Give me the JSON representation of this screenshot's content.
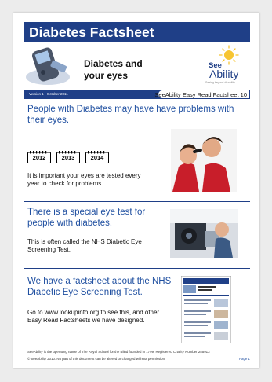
{
  "header": {
    "title": "Diabetes Factsheet",
    "subtitle": "Diabetes and\nyour eyes",
    "logo_see": "See",
    "logo_ability": "Ability",
    "logo_tagline": "Seeing beyond disability",
    "version": "Version 1 - October 2011",
    "series": "SeeAbility Easy Read Factsheet 10"
  },
  "section1": {
    "heading": "People with Diabetes may have have problems with their eyes.",
    "calendar_years": [
      "2012",
      "2013",
      "2014"
    ],
    "body": "It is important your eyes are tested every year to check for problems."
  },
  "section2": {
    "heading": "There is a special eye test for people with diabetes.",
    "body": "This is often called the NHS Diabetic Eye Screening Test."
  },
  "section3": {
    "heading": "We have a factsheet about the NHS Diabetic Eye Screening Test.",
    "body": "Go to www.lookupinfo.org to see this, and other Easy Read Factsheets we have designed."
  },
  "footer": {
    "line1": "SeeAbility is the operating name of The Royal School for the Blind founded in 1799. Registered Charity Number 255913",
    "line2": "© SeeAbility 2010.  No part of this document can be altered or changed without permission",
    "page": "Page 1"
  }
}
